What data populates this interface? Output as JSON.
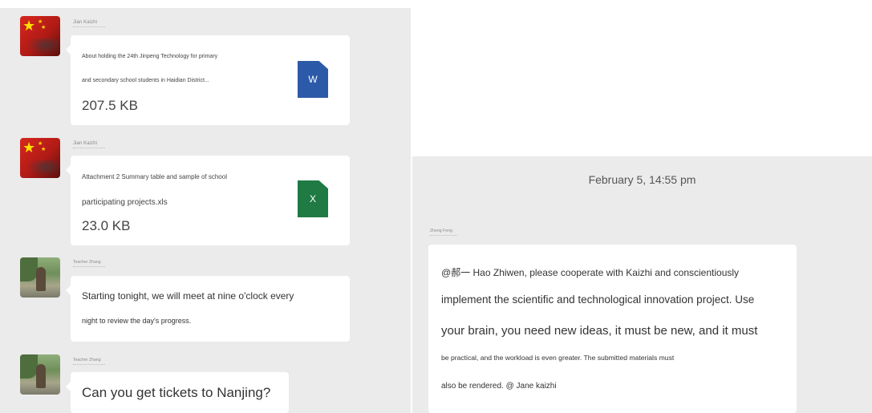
{
  "messages": [
    {
      "sender": "Jian Kaizhi",
      "file_name_line1": "About holding the 24th Jinpeng Technology for primary",
      "file_name_line2": "and secondary school students in Haidian District...",
      "file_size": "207.5 KB",
      "file_icon": "word-document-icon",
      "file_icon_label": "W",
      "accent": "#2b5aa8"
    },
    {
      "sender": "Jian Kaizhi",
      "file_name_line1": "Attachment 2 Summary table and sample of school",
      "file_name_line2": "participating projects.xls",
      "file_size": "23.0 KB",
      "file_icon": "excel-spreadsheet-icon",
      "file_icon_label": "X",
      "accent": "#1f7a44"
    },
    {
      "sender": "Teacher Zhang",
      "line1": "Starting tonight, we will meet at nine o'clock every",
      "line2": "night to review the day's progress."
    },
    {
      "sender": "Teacher Zhang",
      "line1": "Can you get tickets to Nanjing?"
    }
  ],
  "right": {
    "timestamp": "February 5, 14:55 pm",
    "sender": "Zheng Feng",
    "lines": [
      "@郝一 Hao Zhiwen, please cooperate with Kaizhi and conscientiously",
      "implement the scientific and technological innovation project. Use",
      "your brain, you need new ideas, it must be new, and it must",
      "be practical, and the workload is even greater. The submitted materials must",
      "also be rendered. @ Jane kaizhi"
    ]
  }
}
